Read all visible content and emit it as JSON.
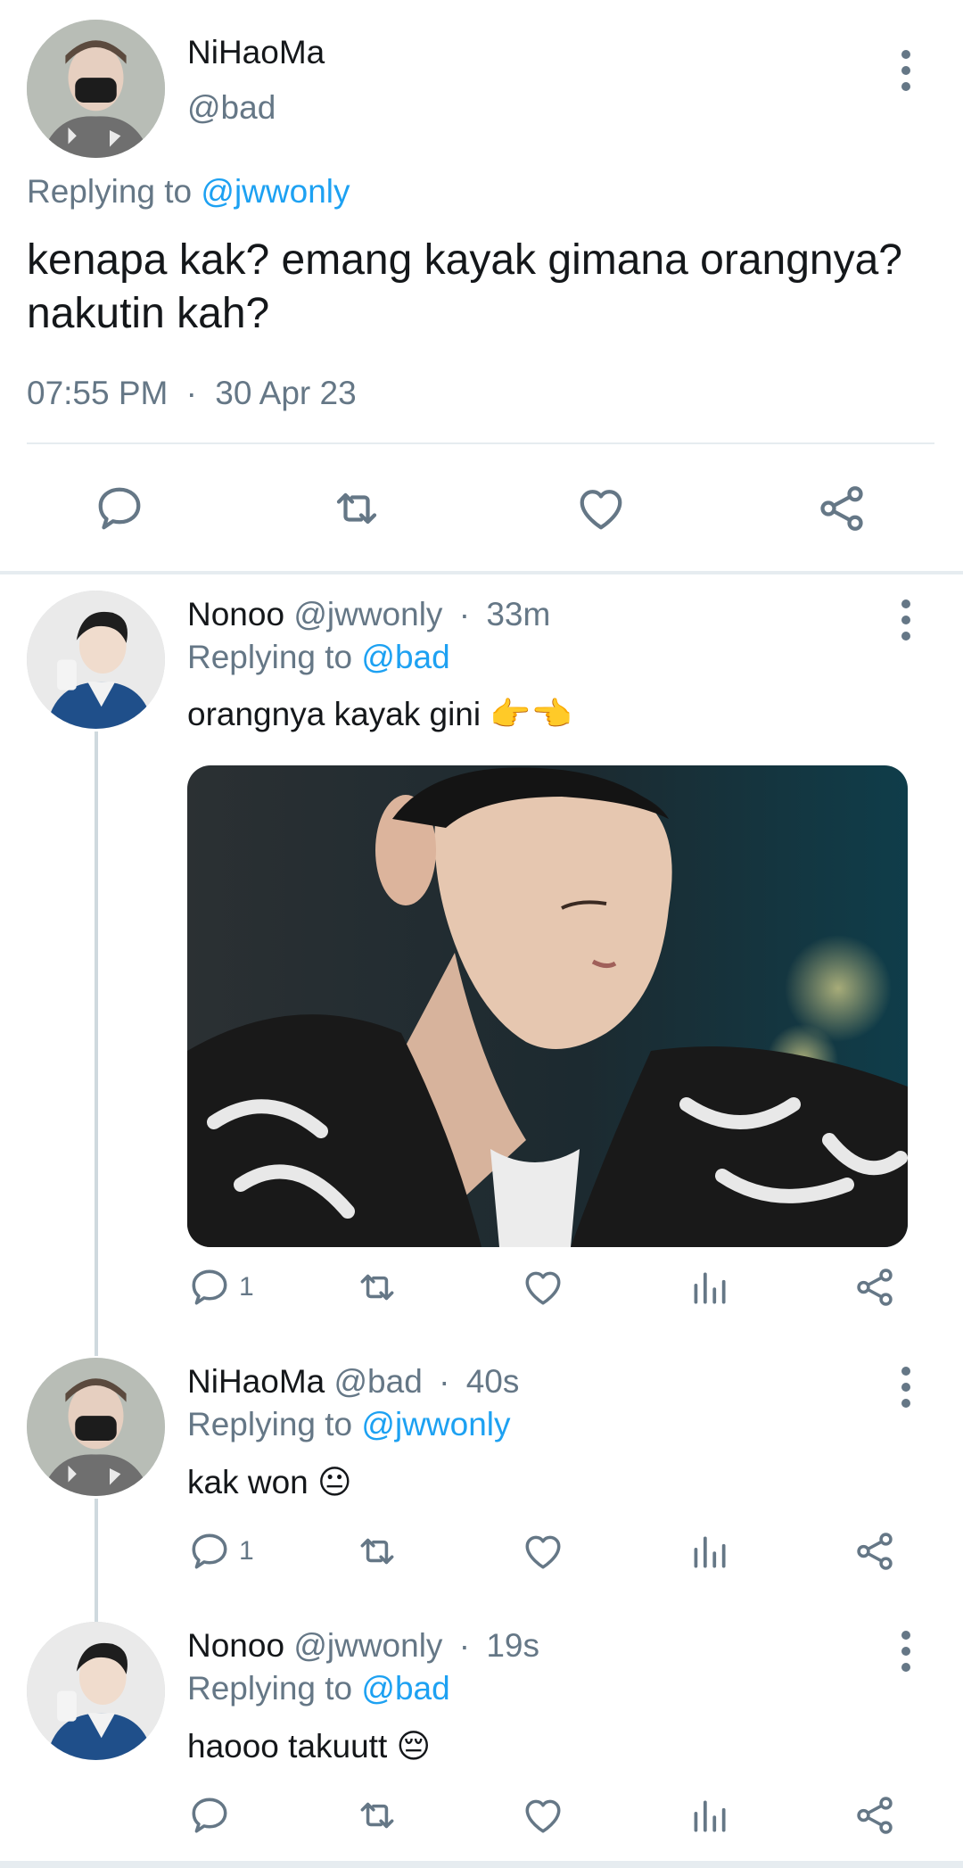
{
  "main_tweet": {
    "name": "NiHaoMa",
    "handle": "@bad",
    "replying_prefix": "Replying to",
    "replying_to": "@jwwonly",
    "text_line1": "kenapa kak? emang kayak gimana orangnya?",
    "text_line2": "nakutin kah?",
    "time": "07:55 PM",
    "dot": "·",
    "date": "30 Apr 23"
  },
  "replies": [
    {
      "name": "Nonoo",
      "handle": "@jwwonly",
      "dot": "·",
      "time": "33m",
      "replying_prefix": "Replying to",
      "replying_to": "@bad",
      "text": "orangnya kayak gini",
      "emoji": "👉👈",
      "reply_count": "1"
    },
    {
      "name": "NiHaoMa",
      "handle": "@bad",
      "dot": "·",
      "time": "40s",
      "replying_prefix": "Replying to",
      "replying_to": "@jwwonly",
      "text": "kak won",
      "emoji": "😐",
      "reply_count": "1"
    },
    {
      "name": "Nonoo",
      "handle": "@jwwonly",
      "dot": "·",
      "time": "19s",
      "replying_prefix": "Replying to",
      "replying_to": "@bad",
      "text": "haooo takuutt",
      "emoji": "😔"
    }
  ],
  "colors": {
    "link": "#1da1f2",
    "secondary": "#657786",
    "divider": "#e6ecf0"
  },
  "icons": [
    "reply-icon",
    "retweet-icon",
    "like-icon",
    "share-icon",
    "analytics-icon",
    "more-icon"
  ]
}
